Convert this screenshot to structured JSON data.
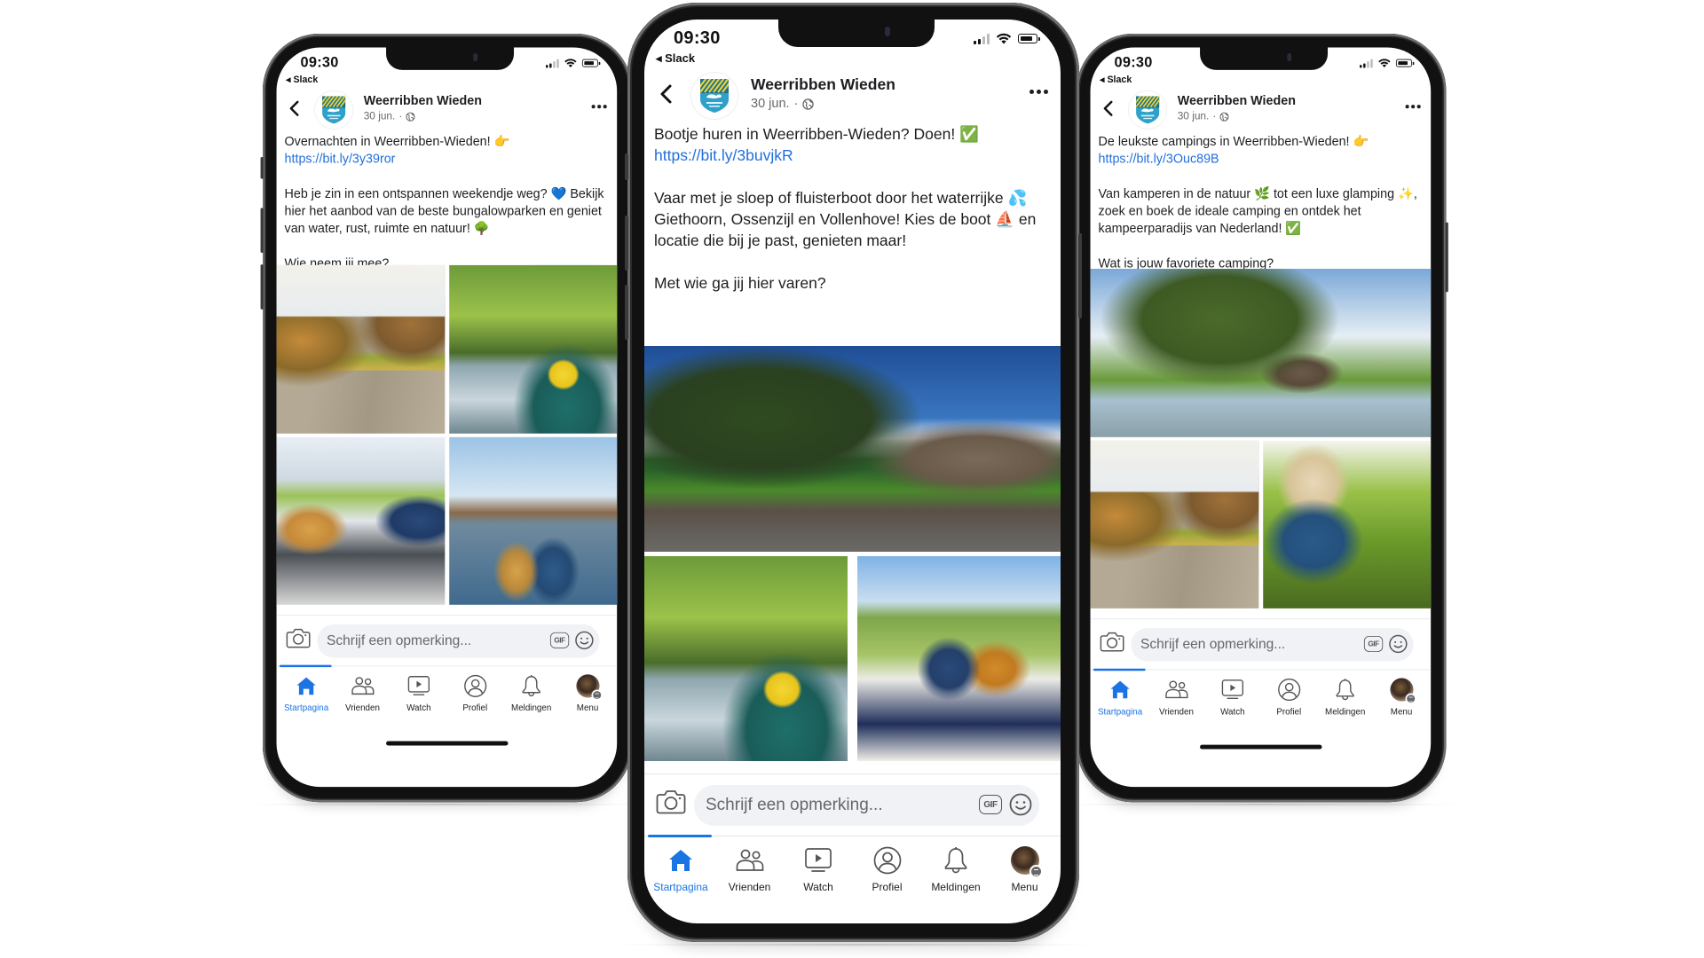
{
  "phones": [
    {
      "id": "left",
      "status": {
        "time": "09:30",
        "back_app": "◂ Slack"
      },
      "post": {
        "page_name": "Weerribben Wieden",
        "date": "30 jun.",
        "separator": "·",
        "paragraphs": [
          {
            "text": "Overnachten in Weerribben-Wieden! 👉 ",
            "link": "https://bit.ly/3y39ror"
          },
          {
            "text": "Heb je zin in een ontspannen weekendje weg? 💙 Bekijk hier het aanbod van de beste bungalowparken en geniet van water, rust, ruimte en natuur! 🌳"
          },
          {
            "text": "Wie neem jij mee?"
          }
        ],
        "photos": [
          {
            "subject": "Couple cycling on a country road"
          },
          {
            "subject": "Couple paddling a green canoe"
          },
          {
            "subject": "Couple dining on a harbour terrace"
          },
          {
            "subject": "Couple looking out over the water at a town"
          }
        ]
      },
      "comment": {
        "placeholder": "Schrijf een opmerking...",
        "gif_label": "GIF"
      }
    },
    {
      "id": "center",
      "status": {
        "time": "09:30",
        "back_app": "◂ Slack"
      },
      "post": {
        "page_name": "Weerribben Wieden",
        "date": "30 jun.",
        "separator": "·",
        "paragraphs": [
          {
            "text": "Bootje huren in Weerribben-Wieden? Doen! ✅ ",
            "link": "https://bit.ly/3buvjkR"
          },
          {
            "text": "Vaar met je sloep of fluisterboot door het waterrijke 💦 Giethoorn, Ossenzijl en Vollenhove! Kies de boot ⛵ en locatie die bij je past, genieten maar!"
          },
          {
            "text": "Met wie ga jij hier varen?"
          }
        ],
        "photos": [
          {
            "subject": "Thatched farmhouse by a canal with a boat"
          },
          {
            "subject": "Couple paddling a green canoe"
          },
          {
            "subject": "Couple reading in a sloop boat"
          }
        ]
      },
      "comment": {
        "placeholder": "Schrijf een opmerking...",
        "gif_label": "GIF"
      }
    },
    {
      "id": "right",
      "status": {
        "time": "09:30",
        "back_app": "◂ Slack"
      },
      "post": {
        "page_name": "Weerribben Wieden",
        "date": "30 jun.",
        "separator": "·",
        "paragraphs": [
          {
            "text": "De leukste campings in Weerribben-Wieden! 👉 ",
            "link": "https://bit.ly/3Ouc89B"
          },
          {
            "text": "Van kamperen in de natuur 🌿  tot een luxe glamping ✨, zoek en boek de ideale camping en ontdek het kampeerparadijs van Nederland! ✅"
          },
          {
            "text": "Wat is jouw favoriete camping?"
          }
        ],
        "photos": [
          {
            "subject": "Cottage with white bridge beside a pond"
          },
          {
            "subject": "Couple cycling on a country road"
          },
          {
            "subject": "Child walking through tall grass"
          }
        ]
      },
      "comment": {
        "placeholder": "Schrijf een opmerking...",
        "gif_label": "GIF"
      }
    }
  ],
  "tabbar": {
    "items": [
      {
        "key": "home",
        "label": "Startpagina",
        "icon": "home-icon",
        "active": true
      },
      {
        "key": "friends",
        "label": "Vrienden",
        "icon": "friends-icon"
      },
      {
        "key": "watch",
        "label": "Watch",
        "icon": "watch-icon"
      },
      {
        "key": "profile",
        "label": "Profiel",
        "icon": "profile-icon"
      },
      {
        "key": "notifications",
        "label": "Meldingen",
        "icon": "bell-icon"
      },
      {
        "key": "menu",
        "label": "Menu",
        "icon": "menu-avatar-icon"
      }
    ]
  },
  "colors": {
    "accent": "#1b74e4",
    "link": "#216fdb",
    "text": "#1c1e21",
    "secondary_text": "#65676b",
    "input_bg": "#f0f2f5"
  }
}
